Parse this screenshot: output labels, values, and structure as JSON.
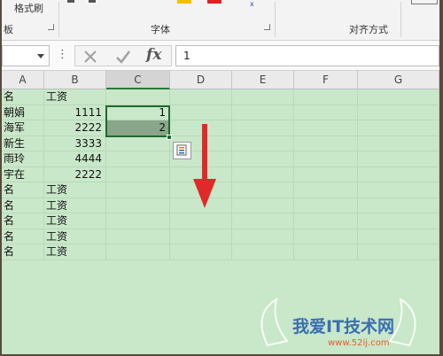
{
  "ribbon": {
    "format_painter": "格式刷",
    "clipboard_group": "板",
    "font_group": "字体",
    "alignment_group": "对齐方式"
  },
  "formula_bar": {
    "value": "1",
    "fx": "fx"
  },
  "columns": [
    "A",
    "B",
    "C",
    "D",
    "E",
    "F",
    "G"
  ],
  "rows": [
    {
      "a": "名",
      "b": "工资",
      "c": ""
    },
    {
      "a": "朝娟",
      "b": "1111",
      "c": "1"
    },
    {
      "a": "海军",
      "b": "2222",
      "c": "2"
    },
    {
      "a": "新生",
      "b": "3333",
      "c": ""
    },
    {
      "a": "雨玲",
      "b": "4444",
      "c": ""
    },
    {
      "a": "宇在",
      "b": "2222",
      "c": ""
    },
    {
      "a": "名",
      "b": "工资",
      "c": ""
    },
    {
      "a": "名",
      "b": "工资",
      "c": ""
    },
    {
      "a": "名",
      "b": "工资",
      "c": ""
    },
    {
      "a": "名",
      "b": "工资",
      "c": ""
    },
    {
      "a": "名",
      "b": "工资",
      "c": ""
    }
  ],
  "watermark": {
    "title": "我爱IT技术网",
    "url": "www.52ij.com"
  },
  "colors": {
    "grid_bg": "#c9e7c9",
    "selection_border": "#1e6a2e",
    "arrow": "#e02a2a"
  }
}
